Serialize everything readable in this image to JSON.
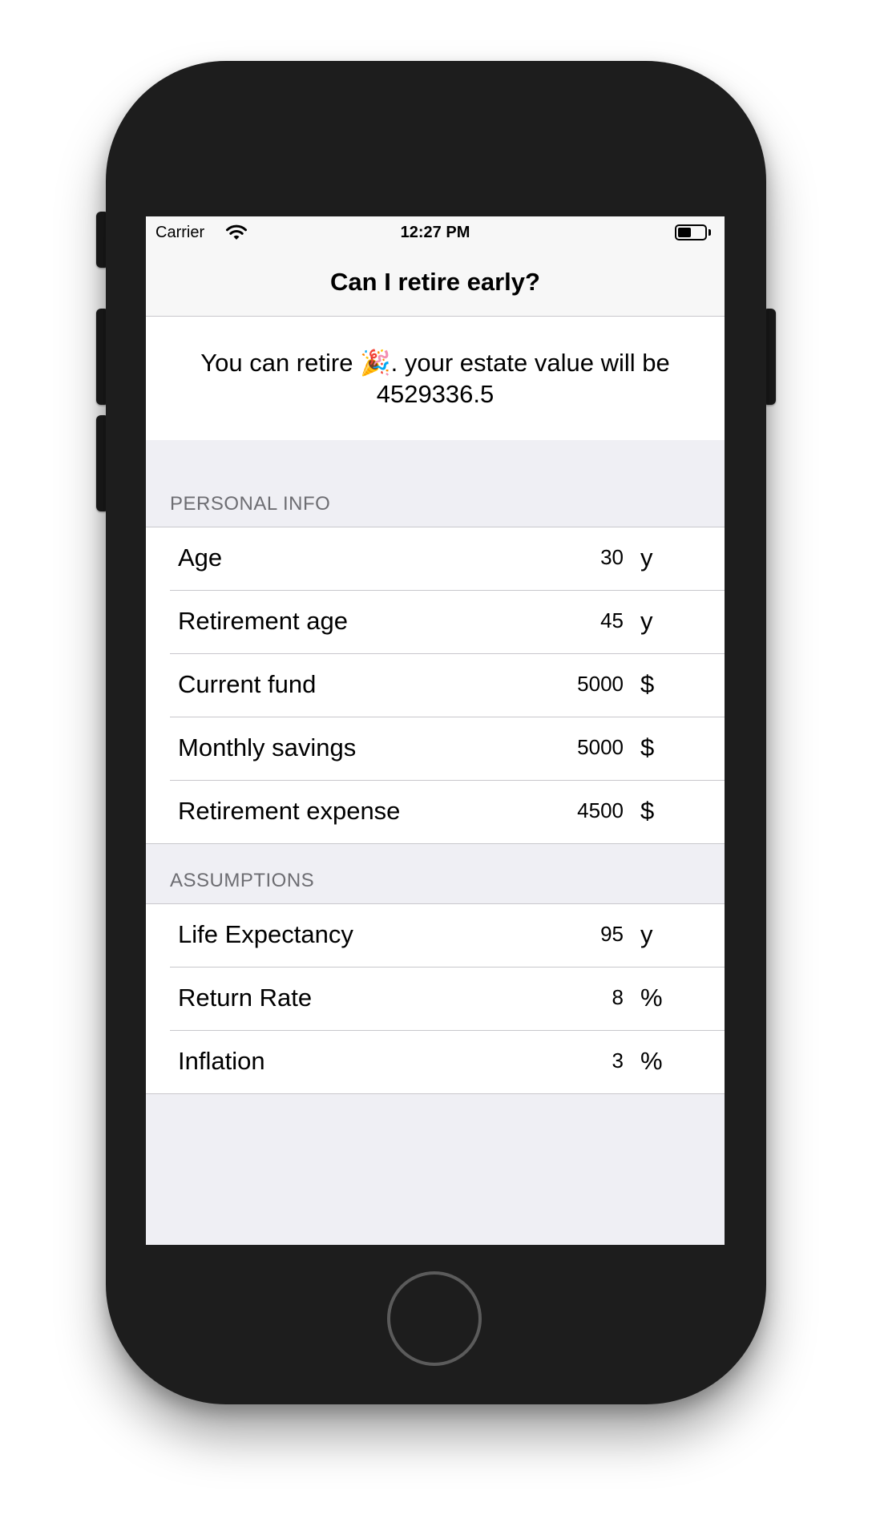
{
  "status_bar": {
    "carrier": "Carrier",
    "time": "12:27 PM",
    "icons": [
      "wifi-icon",
      "battery-icon"
    ]
  },
  "nav": {
    "title": "Can I retire early?"
  },
  "result": {
    "text": "You can retire 🎉. your estate value will be 4529336.5"
  },
  "personal_info": {
    "header": "PERSONAL INFO",
    "rows": [
      {
        "label": "Age",
        "value": "30",
        "unit": "y"
      },
      {
        "label": "Retirement age",
        "value": "45",
        "unit": "y"
      },
      {
        "label": "Current fund",
        "value": "5000",
        "unit": "$"
      },
      {
        "label": "Monthly savings",
        "value": "5000",
        "unit": "$"
      },
      {
        "label": "Retirement expense",
        "value": "4500",
        "unit": "$"
      }
    ]
  },
  "assumptions": {
    "header": "ASSUMPTIONS",
    "rows": [
      {
        "label": "Life Expectancy",
        "value": "95",
        "unit": "y"
      },
      {
        "label": "Return Rate",
        "value": "8",
        "unit": "%"
      },
      {
        "label": "Inflation",
        "value": "3",
        "unit": "%"
      }
    ]
  },
  "colors": {
    "phone_body": "#1d1d1d",
    "grouped_background": "#efeff4",
    "bar_background": "#f7f7f7",
    "separator": "#c8c7cc",
    "section_header_text": "#6d6d72"
  }
}
